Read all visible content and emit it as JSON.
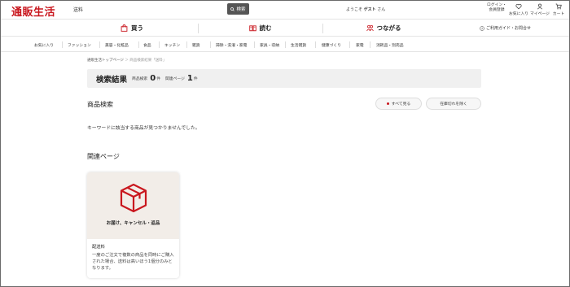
{
  "header": {
    "logo": "通販生活",
    "search_value": "送料",
    "search_button": "検索",
    "welcome_prefix": "ようこそ",
    "welcome_user": "ゲスト",
    "welcome_suffix": "さん",
    "login_line1": "ログイン・",
    "login_line2": "会員登録",
    "favorites": "お気に入り",
    "mypage": "マイページ",
    "cart": "カート"
  },
  "main_nav": {
    "tabs": [
      {
        "label": "買う",
        "icon": "shopping-bag-icon"
      },
      {
        "label": "読む",
        "icon": "book-icon"
      },
      {
        "label": "つながる",
        "icon": "people-icon"
      }
    ],
    "guide": "ご利用ガイド・お問合せ"
  },
  "categories": [
    "お気に入り",
    "ファッション",
    "美容・化粧品",
    "食品",
    "キッチン",
    "雑貨",
    "掃除・洗濯・家電",
    "家具・収納",
    "生活雑貨",
    "健康づくり",
    "家電",
    "消耗品・別売品"
  ],
  "breadcrumb": {
    "home": "通販生活トップページ",
    "separator": "＞",
    "current": "商品検索結果「送料」"
  },
  "result": {
    "title": "検索結果",
    "product_label": "商品検索",
    "product_count": "0",
    "unit1": "件",
    "page_label": "関連ページ",
    "page_count": "1",
    "unit2": "件"
  },
  "product_section": {
    "title": "商品検索",
    "show_all": "すべて見る",
    "exclude_out_of_stock": "在庫切れを除く",
    "no_results": "キーワードに該当する商品が見つかりませんでした。"
  },
  "related_section": {
    "title": "関連ページ",
    "card": {
      "image_caption": "お届け、キャンセル・返品",
      "name": "配送料",
      "description": "一度のご注文で複数の商品を同時にご購入された場合、送料は高いほう1個分のみとなります。"
    }
  },
  "colors": {
    "brand": "#c9171e",
    "search_button": "#555555",
    "result_bar": "#f0f0f0",
    "card_image_bg": "#f2ede8"
  }
}
